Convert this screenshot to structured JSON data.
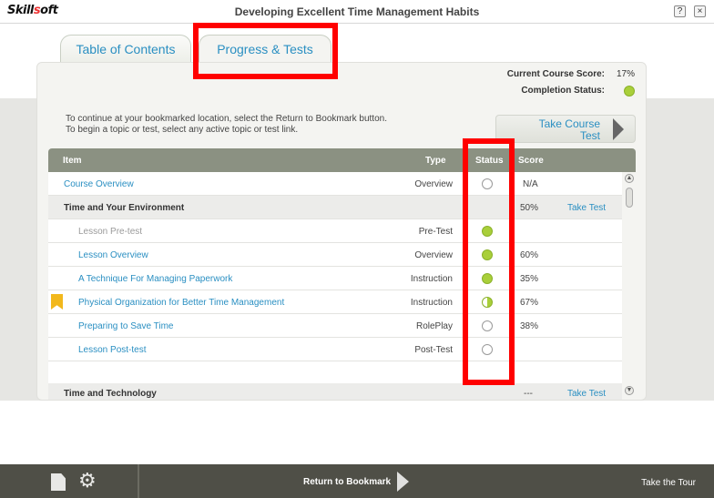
{
  "window": {
    "logo_prefix": "Skill",
    "logo_accent": "s",
    "logo_suffix": "oft",
    "title": "Developing Excellent Time Management Habits",
    "help_btn": "?",
    "close_btn": "×"
  },
  "tabs": {
    "toc": "Table of Contents",
    "progress": "Progress & Tests"
  },
  "summary": {
    "score_label": "Current Course Score:",
    "score_value": "17%",
    "completion_label": "Completion Status:",
    "completion_color": "#a9cf3a"
  },
  "instructions": {
    "line1": "To continue at your bookmarked location, select the Return to Bookmark button.",
    "line2": "To begin a topic or test, select any active topic or test link."
  },
  "take_course_test": {
    "line1": "Take Course",
    "line2": "Test"
  },
  "table": {
    "headers": {
      "item": "Item",
      "type": "Type",
      "status": "Status",
      "score": "Score"
    },
    "rows": [
      {
        "item": "Course Overview",
        "type": "Overview",
        "status": "not-started",
        "score": "N/A",
        "link": ""
      },
      {
        "item": "Time and Your Environment",
        "type": "",
        "status": "",
        "score": "50%",
        "link": "Take Test",
        "section": true
      },
      {
        "item": "Lesson Pre-test",
        "type": "Pre-Test",
        "status": "complete",
        "score": "",
        "link": "",
        "disabled": true
      },
      {
        "item": "Lesson Overview",
        "type": "Overview",
        "status": "complete",
        "score": "60%",
        "link": ""
      },
      {
        "item": "A Technique For Managing Paperwork",
        "type": "Instruction",
        "status": "complete",
        "score": "35%",
        "link": ""
      },
      {
        "item": "Physical Organization for Better Time Management",
        "type": "Instruction",
        "status": "partial",
        "score": "67%",
        "link": "",
        "bookmark": true
      },
      {
        "item": "Preparing to Save Time",
        "type": "RolePlay",
        "status": "not-started",
        "score": "38%",
        "link": ""
      },
      {
        "item": "Lesson Post-test",
        "type": "Post-Test",
        "status": "not-started",
        "score": "",
        "link": ""
      },
      {
        "item": "Time and Technology",
        "type": "",
        "status": "",
        "score": "---",
        "link": "Take Test",
        "section": true
      }
    ]
  },
  "footer": {
    "return_label": "Return to Bookmark",
    "tour_label": "Take the Tour"
  },
  "colors": {
    "accent": "#2a8fc2",
    "header": "#8b9182",
    "footer": "#4f4f47",
    "highlight": "#ff0000"
  }
}
